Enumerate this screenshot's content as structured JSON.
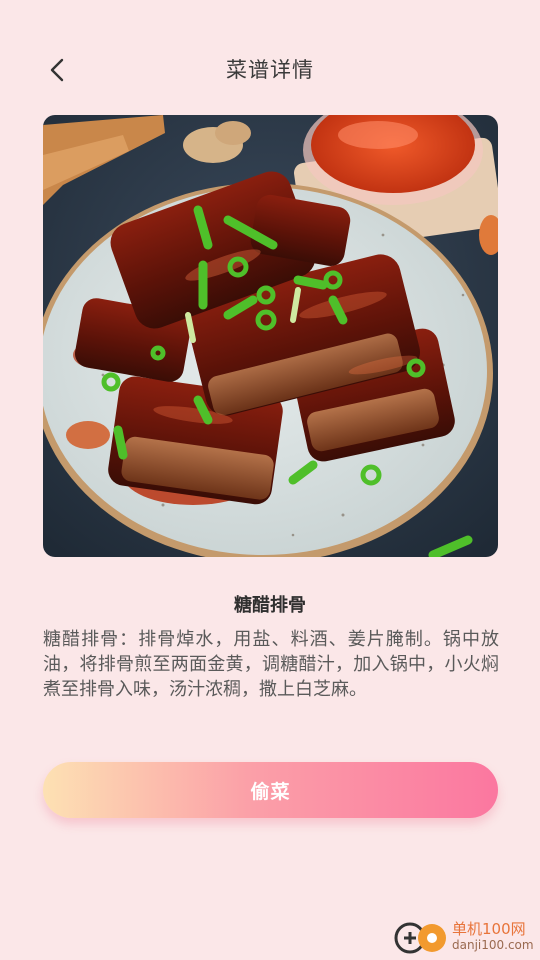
{
  "header": {
    "title": "菜谱详情"
  },
  "recipe": {
    "name": "糖醋排骨",
    "description": "糖醋排骨：排骨焯水，用盐、料酒、姜片腌制。锅中放油，将排骨煎至两面金黄，调糖醋汁，加入锅中，小火焖煮至排骨入味，汤汁浓稠，撒上白芝麻。"
  },
  "action": {
    "label": "偷菜"
  },
  "watermark": {
    "brand": "单机100网",
    "url": "danji100.com"
  },
  "icons": {
    "back": "back-chevron-icon"
  },
  "colors": {
    "background": "#fbe7e8",
    "button_start": "#fde1b3",
    "button_end": "#fb77a0"
  }
}
